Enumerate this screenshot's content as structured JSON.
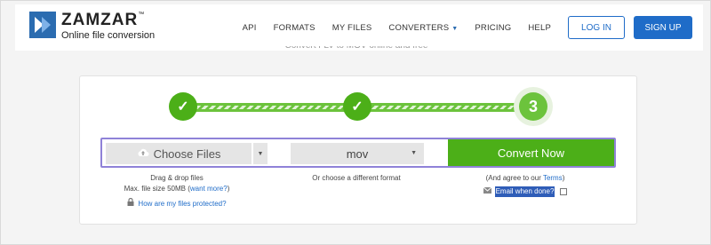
{
  "header": {
    "logo_title": "ZAMZAR",
    "logo_tm": "™",
    "logo_subtitle": "Online file conversion",
    "nav": [
      {
        "label": "API"
      },
      {
        "label": "FORMATS"
      },
      {
        "label": "MY FILES"
      },
      {
        "label": "CONVERTERS"
      },
      {
        "label": "PRICING"
      },
      {
        "label": "HELP"
      }
    ],
    "login_label": "LOG IN",
    "signup_label": "SIGN UP"
  },
  "page_subtitle": "Convert FLV to MOV online and free",
  "steps": [
    {
      "label": "✓",
      "state": "complete"
    },
    {
      "label": "✓",
      "state": "complete"
    },
    {
      "label": "3",
      "state": "current"
    }
  ],
  "converter": {
    "choose_files_label": "Choose Files",
    "choose_files_icon": "cloud-upload-icon",
    "format_value": "mov",
    "convert_label": "Convert Now",
    "drag_drop_text": "Drag & drop files",
    "max_size_text": "Max. file size 50MB (",
    "want_more_link": "want more?",
    "max_size_suffix": ")",
    "protected_link": "How are my files protected?",
    "format_hint": "Or choose a different format",
    "agree_text": "(And agree to our ",
    "terms_link": "Terms",
    "agree_suffix": ")",
    "email_label": "Email when done?"
  },
  "colors": {
    "brand_blue": "#1f6cc8",
    "green": "#4caf18",
    "highlight_border": "#8f82d8"
  }
}
